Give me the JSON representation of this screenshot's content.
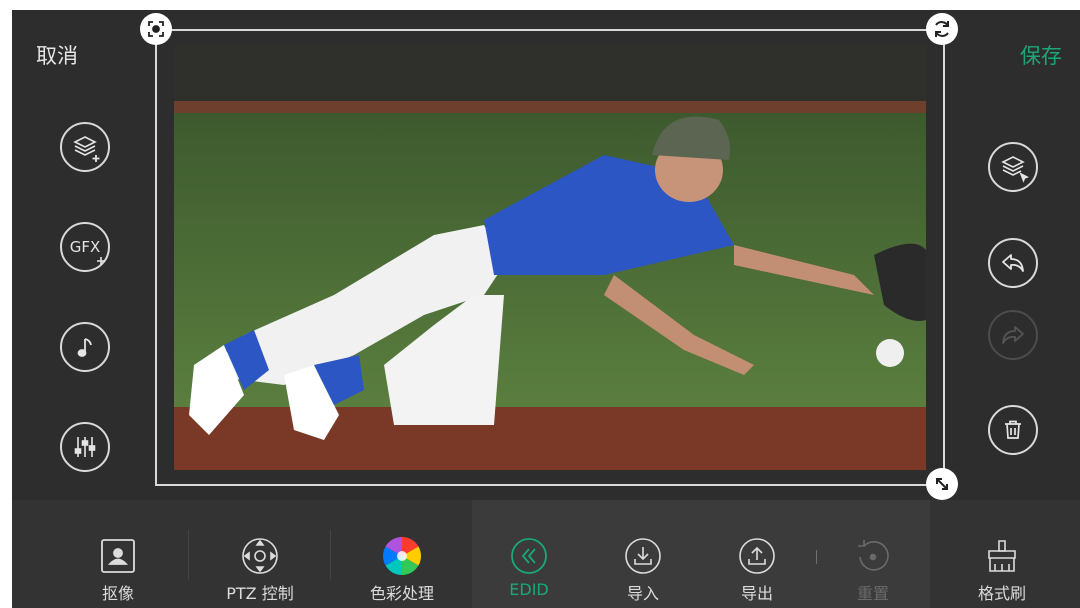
{
  "header": {
    "cancel_label": "取消",
    "save_label": "保存"
  },
  "left_tools": [
    {
      "icon": "add-layer-icon"
    },
    {
      "icon": "add-gfx-icon",
      "text": "GFX"
    },
    {
      "icon": "music-note-icon"
    },
    {
      "icon": "equalizer-sliders-icon"
    }
  ],
  "right_tools": [
    {
      "icon": "select-layer-icon"
    },
    {
      "icon": "undo-icon"
    },
    {
      "icon": "redo-icon",
      "state": "disabled"
    },
    {
      "icon": "trash-icon"
    }
  ],
  "preview": {
    "handles": [
      "focus-lock-icon",
      "rotate-icon",
      "resize-icon"
    ]
  },
  "toolbar": {
    "items": [
      {
        "label": "抠像",
        "icon": "portrait-matting-icon"
      },
      {
        "label": "PTZ 控制",
        "icon": "ptz-joystick-icon"
      },
      {
        "label": "色彩处理",
        "icon": "color-wheel-icon"
      },
      {
        "label": "EDID",
        "icon": "double-chevron-left-icon",
        "state": "active"
      },
      {
        "label": "导入",
        "icon": "import-icon"
      },
      {
        "label": "导出",
        "icon": "export-icon"
      },
      {
        "label": "重置",
        "icon": "reset-icon",
        "state": "disabled"
      },
      {
        "label": "格式刷",
        "icon": "format-brush-icon"
      }
    ]
  },
  "colors": {
    "accent": "#1aa877",
    "panel": "#2d2d2d",
    "toolbar": "#333333"
  }
}
